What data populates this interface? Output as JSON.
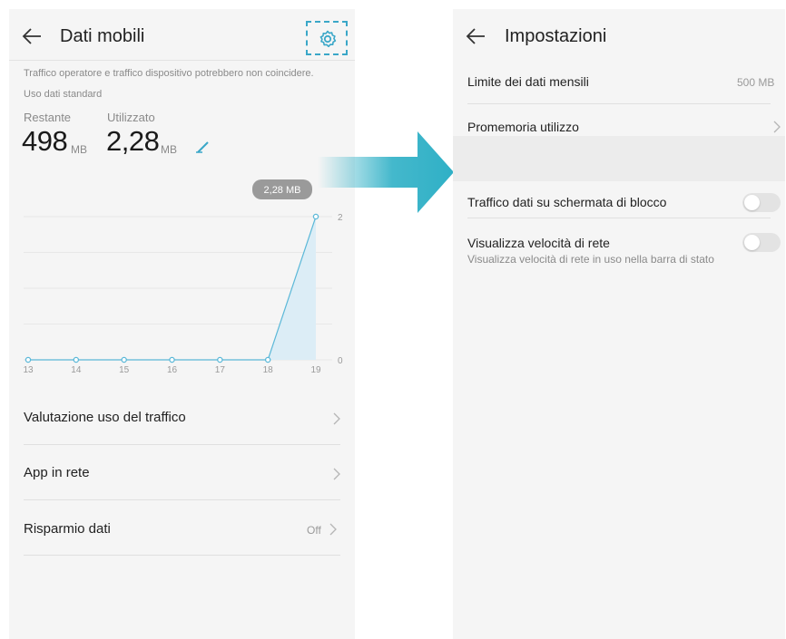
{
  "left": {
    "title": "Dati mobili",
    "disclaimer": "Traffico operatore e traffico dispositivo potrebbero non coincidere.",
    "plan": "Uso dati standard",
    "remaining": {
      "label": "Restante",
      "value": "498",
      "unit": "MB"
    },
    "used": {
      "label": "Utilizzato",
      "value": "2,28",
      "unit": "MB"
    },
    "chart_data": {
      "type": "area",
      "x": [
        13,
        14,
        15,
        16,
        17,
        18,
        19
      ],
      "values": [
        0,
        0,
        0,
        0,
        0,
        0,
        2.28
      ],
      "x_tick_labels": [
        "13",
        "14",
        "15",
        "16",
        "17",
        "18",
        "19"
      ],
      "y_tick_labels": [
        "2",
        "0"
      ],
      "ylim": [
        0,
        2
      ],
      "annotation": "2,28 MB",
      "line_color": "#5bb8d8",
      "fill_color": "#dcefF7"
    },
    "menu": [
      {
        "label": "Valutazione uso del traffico",
        "value": ""
      },
      {
        "label": "App in rete",
        "value": ""
      },
      {
        "label": "Risparmio dati",
        "value": "Off"
      }
    ]
  },
  "right": {
    "title": "Impostazioni",
    "monthly_limit": {
      "label": "Limite dei dati mensili",
      "value": "500 MB"
    },
    "reminder": {
      "label": "Promemoria utilizzo"
    },
    "lockscreen": {
      "label": "Traffico dati su schermata di blocco",
      "on": false
    },
    "network_speed": {
      "label": "Visualizza velocità di rete",
      "description": "Visualizza velocità di rete in uso nella barra di stato",
      "on": false
    }
  },
  "colors": {
    "accent": "#3aa7c8",
    "arrow": "#2fb0c6"
  }
}
